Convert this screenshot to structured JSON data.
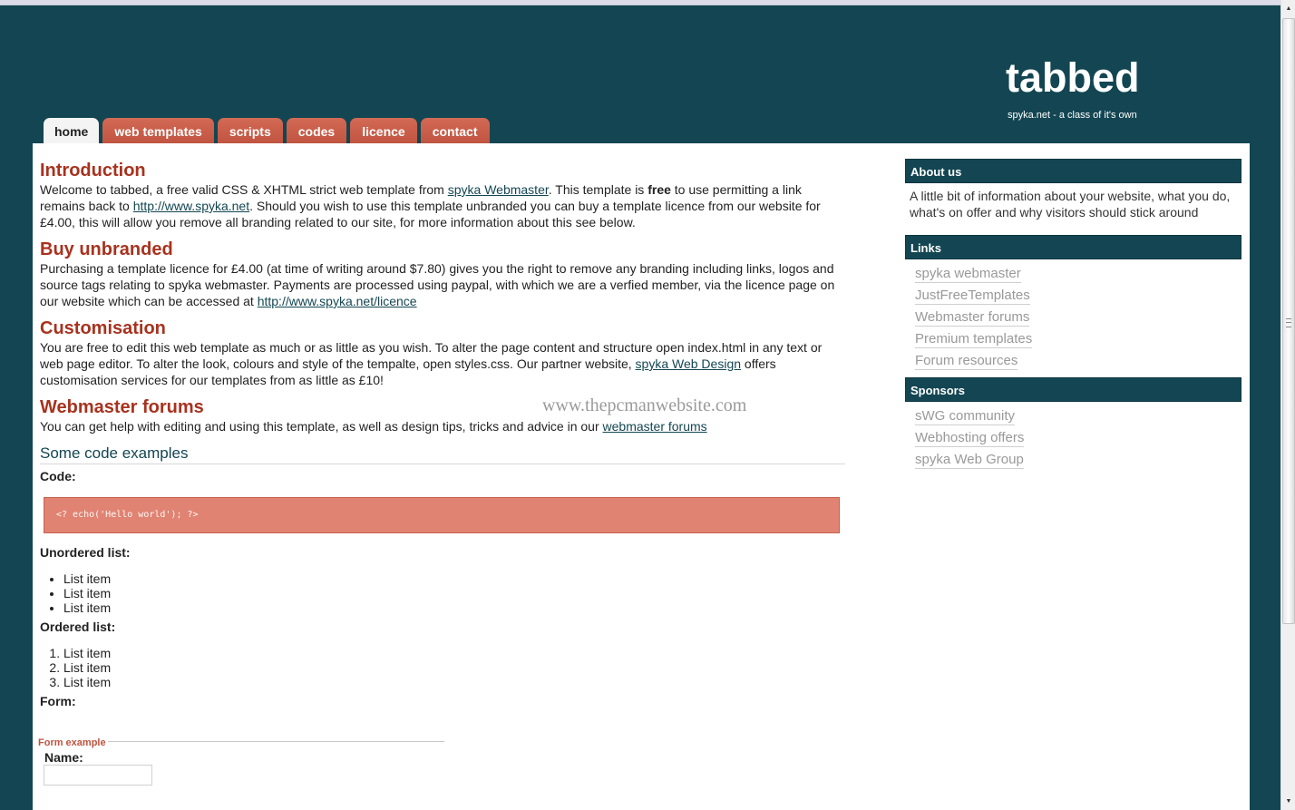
{
  "header": {
    "logo": "tabbed",
    "slogan": "spyka.net - a class of it's own"
  },
  "tabs": [
    {
      "label": "home",
      "active": true
    },
    {
      "label": "web templates",
      "active": false
    },
    {
      "label": "scripts",
      "active": false
    },
    {
      "label": "codes",
      "active": false
    },
    {
      "label": "licence",
      "active": false
    },
    {
      "label": "contact",
      "active": false
    }
  ],
  "main": {
    "intro": {
      "title": "Introduction",
      "t1": "Welcome to tabbed, a free valid CSS & XHTML strict web template from ",
      "link1": "spyka Webmaster",
      "t2": ". This template is ",
      "bold": "free",
      "t3": " to use permitting a link remains back to ",
      "link2": "http://www.spyka.net",
      "t4": ". Should you wish to use this template unbranded you can buy a template licence from our website for £4.00, this will allow you remove all branding related to our site, for more information about this see below."
    },
    "buy": {
      "title": "Buy unbranded",
      "t1": "Purchasing a template licence for £4.00 (at time of writing around $7.80) gives you the right to remove any branding including links, logos and source tags relating to spyka webmaster. Payments are processed using paypal, with which we are a verfied member, via the licence page on our website which can be accessed at ",
      "link": "http://www.spyka.net/licence"
    },
    "custom": {
      "title": "Customisation",
      "t1": "You are free to edit this web template as much or as little as you wish. To alter the page content and structure open index.html in any text or web page editor. To alter the look, colours and style of the tempalte, open styles.css. Our partner website, ",
      "link": "spyka Web Design",
      "t2": " offers customisation services for our templates from as little as £10!"
    },
    "forums": {
      "title": "Webmaster forums",
      "t1": "You can get help with editing and using this template, as well as design tips, tricks and advice in our ",
      "link": "webmaster forums"
    },
    "examples": {
      "title": "Some code examples",
      "code_label": "Code:",
      "code": "<? echo('Hello world'); ?>",
      "ul_label": "Unordered list:",
      "ul_items": [
        "List item",
        "List item",
        "List item"
      ],
      "ol_label": "Ordered list:",
      "ol_items": [
        "List item",
        "List item",
        "List item"
      ],
      "form_label": "Form:",
      "legend": "Form example",
      "name_label": "Name:",
      "name_value": ""
    }
  },
  "watermark": "www.thepcmanwebsite.com",
  "sidebar": {
    "about_title": "About us",
    "about_text": "A little bit of information about your website, what you do, what's on offer and why visitors should stick around",
    "links_title": "Links",
    "links": [
      "spyka webmaster",
      "JustFreeTemplates",
      "Webmaster forums",
      "Premium templates",
      "Forum resources"
    ],
    "sponsors_title": "Sponsors",
    "sponsors": [
      "sWG community",
      "Webhosting offers",
      "spyka Web Group"
    ]
  },
  "scrollbar": {
    "up": "▲",
    "down": "▼"
  }
}
